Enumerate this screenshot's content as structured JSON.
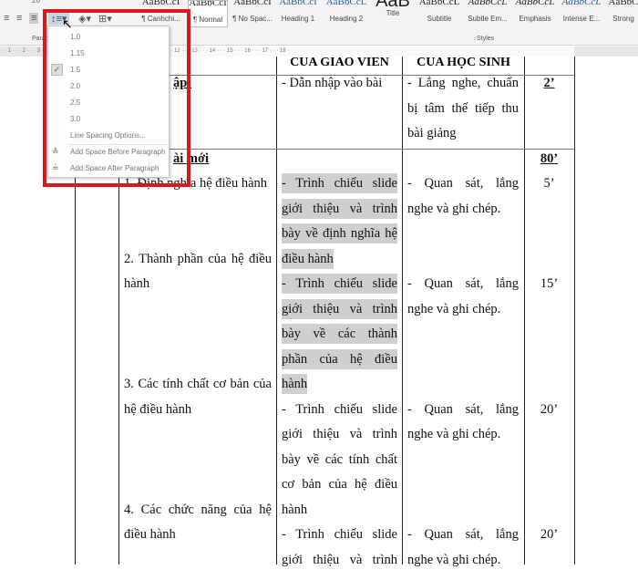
{
  "ribbon": {
    "styles": [
      {
        "preview": "AaBbCcI",
        "name": "¶ Canhchi..."
      },
      {
        "preview": "AaBbCcI",
        "name": "¶ Normal",
        "selected": true
      },
      {
        "preview": "AaBbCcI",
        "name": "¶ No Spac..."
      },
      {
        "preview": "AaBbCcI",
        "name": "Heading 1"
      },
      {
        "preview": "AaBbCcL",
        "name": "Heading 2"
      },
      {
        "preview": "AaB",
        "name": "Title"
      },
      {
        "preview": "AaBbCcL",
        "name": "Subtitle"
      },
      {
        "preview": "AaBbCcL",
        "name": "Subtle Em..."
      },
      {
        "preview": "AaBbCcL",
        "name": "Emphasis"
      },
      {
        "preview": "AaBbCcL",
        "name": "Intense E..."
      },
      {
        "preview": "AaBbC",
        "name": "Strong"
      }
    ],
    "group_paragraph": "Paragraph",
    "group_styles": "Styles",
    "font_size_partial": "26",
    "icons": {
      "align_left": "align-left-icon",
      "align_right": "align-right-icon",
      "justify": "justify-icon",
      "line_spacing": "line-spacing-icon",
      "shading": "paint-bucket-icon",
      "borders": "borders-icon"
    }
  },
  "ruler": "· 1 · · · 2 · · · 3 · · · 4 · · · 5 · · · 6 · · · 7 · · · 8 · · · 9 · · · 10 · · · 11 · · · 12 · · · 13 · · · 14 · · · 15 · · · 16 · · · 17 · · · 18 ·",
  "line_spacing_menu": {
    "items": [
      "1.0",
      "1.15",
      "1.5",
      "2.0",
      "2.5",
      "3.0"
    ],
    "checked": "1.5",
    "options": "Line Spacing Options...",
    "add_before": "Add Space Before Paragraph",
    "add_after": "Add Space After Paragraph"
  },
  "highlight_color": "#d7191c",
  "table": {
    "headers": [
      "CỦA GIÁO VIÊN",
      "CỦA HỌC SINH"
    ],
    "col1": [
      {
        "text": "ập:",
        "slot": 0,
        "bold": true
      },
      {
        "text": "ài mới",
        "slot": 3,
        "bold": true
      }
    ],
    "col2": [
      {
        "text": "1. Định nghĩa hệ điều hành",
        "slot": 4
      },
      {
        "text": "2. Thành phần của hệ điều",
        "slot": 7,
        "j": true
      },
      {
        "text": "hành",
        "slot": 8
      },
      {
        "text": "3. Các tính chất cơ bản của",
        "slot": 12,
        "j": true
      },
      {
        "text": "hệ điều hành",
        "slot": 13
      },
      {
        "text": "4. Các chức năng của hệ",
        "slot": 17,
        "j": true
      },
      {
        "text": "điều hành",
        "slot": 18
      }
    ],
    "col3": [
      {
        "text": "- Dẫn nhập vào bài",
        "slot": 0
      },
      {
        "text": "- Trình chiếu slide",
        "slot": 4,
        "j": true,
        "hl": true
      },
      {
        "text": "giới thiệu và trình",
        "slot": 5,
        "j": true,
        "hl": true
      },
      {
        "text": "bày về định nghĩa hệ",
        "slot": 6,
        "j": true,
        "hl": true
      },
      {
        "text": "điều hành",
        "slot": 7,
        "hl": true
      },
      {
        "text": "- Trình chiếu slide",
        "slot": 8,
        "j": true,
        "hl": true
      },
      {
        "text": "giới thiệu và trình",
        "slot": 9,
        "j": true,
        "hl": true
      },
      {
        "text": "bày về các thành",
        "slot": 10,
        "j": true,
        "hl": true
      },
      {
        "text": "phần của hệ điều",
        "slot": 11,
        "j": true,
        "hl": true
      },
      {
        "text": "hành",
        "slot": 12,
        "hl": true
      },
      {
        "text": "- Trình chiếu slide",
        "slot": 13,
        "j": true
      },
      {
        "text": "giới thiệu và trình",
        "slot": 14,
        "j": true
      },
      {
        "text": "bày về các tính chất",
        "slot": 15,
        "j": true
      },
      {
        "text": "cơ bản của hệ điều",
        "slot": 16,
        "j": true
      },
      {
        "text": "hành",
        "slot": 17
      },
      {
        "text": "- Trình chiếu slide",
        "slot": 18,
        "j": true
      },
      {
        "text": "giới thiệu và trình",
        "slot": 19,
        "j": true
      }
    ],
    "col4": [
      {
        "text": "- Lắng nghe, chuẩn",
        "slot": 0,
        "j": true
      },
      {
        "text": "bị tâm thế tiếp thu",
        "slot": 1,
        "j": true
      },
      {
        "text": "bài giảng",
        "slot": 2
      },
      {
        "text": "- Quan sát, lắng",
        "slot": 4,
        "j": true
      },
      {
        "text": "nghe và ghi chép.",
        "slot": 5
      },
      {
        "text": "- Quan sát, lắng",
        "slot": 8,
        "j": true
      },
      {
        "text": "nghe và ghi chép.",
        "slot": 9
      },
      {
        "text": "- Quan sát, lắng",
        "slot": 13,
        "j": true
      },
      {
        "text": "nghe và ghi chép.",
        "slot": 14
      },
      {
        "text": "- Quan sát, lắng",
        "slot": 18,
        "j": true
      },
      {
        "text": "nghe và ghi chép.",
        "slot": 19
      }
    ],
    "col5": [
      {
        "text": "2’",
        "slot": 0,
        "bold": true
      },
      {
        "text": "80’",
        "slot": 3,
        "bold": true
      },
      {
        "text": "5’",
        "slot": 4
      },
      {
        "text": "15’",
        "slot": 8
      },
      {
        "text": "20’",
        "slot": 13
      },
      {
        "text": "20’",
        "slot": 18
      }
    ]
  }
}
